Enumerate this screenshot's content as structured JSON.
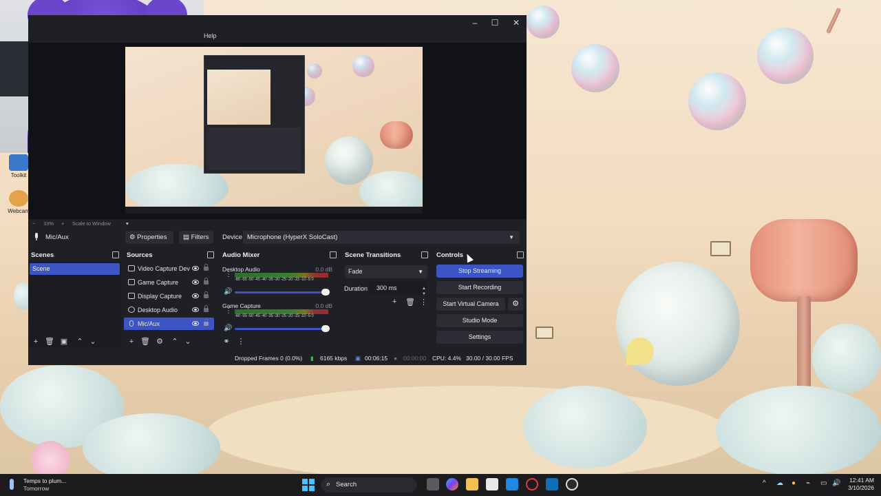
{
  "desktop": {
    "icons": [
      {
        "label": "Toolkit"
      },
      {
        "label": "Webcam"
      }
    ]
  },
  "obs": {
    "window_controls": {
      "minimize": "–",
      "maximize": "☐",
      "close": "✕"
    },
    "menu": {
      "help": "Help"
    },
    "preview_bar": {
      "zoom_minus": "−",
      "zoom_value": "33%",
      "zoom_plus": "+",
      "scale_label": "Scale to Window",
      "caret": "▾"
    },
    "source_toolbar": {
      "source_name": "Mic/Aux",
      "properties_label": "Properties",
      "filters_label": "Filters",
      "device_label": "Device",
      "device_value": "Microphone (HyperX SoloCast)"
    },
    "scenes": {
      "title": "Scenes",
      "items": [
        {
          "label": "Scene"
        }
      ]
    },
    "sources": {
      "title": "Sources",
      "items": [
        {
          "label": "Video Capture Dev"
        },
        {
          "label": "Game Capture"
        },
        {
          "label": "Display Capture"
        },
        {
          "label": "Desktop Audio"
        },
        {
          "label": "Mic/Aux"
        }
      ]
    },
    "audio_mixer": {
      "title": "Audio Mixer",
      "channels": [
        {
          "name": "Desktop Audio",
          "db": "0.0 dB",
          "ticks": "-60 -55 -50 -45 -40 -35 -30 -25 -20 -15 -10 -5 0"
        },
        {
          "name": "Game Capture",
          "db": "0.0 dB",
          "ticks": "-60 -55 -50 -45 -40 -35 -30 -25 -20 -15 -10 -5 0"
        }
      ]
    },
    "scene_transitions": {
      "title": "Scene Transitions",
      "transition": "Fade",
      "duration_label": "Duration",
      "duration_value": "300 ms"
    },
    "controls": {
      "title": "Controls",
      "stop_streaming": "Stop Streaming",
      "start_recording": "Start Recording",
      "start_virtual_camera": "Start Virtual Camera",
      "studio_mode": "Studio Mode",
      "settings": "Settings"
    },
    "status": {
      "dropped_frames": "Dropped Frames 0 (0.0%)",
      "bitrate": "6165 kbps",
      "stream_time": "00:06:15",
      "record_time": "00:00:00",
      "cpu": "CPU: 4.4%",
      "fps": "30.00 / 30.00 FPS"
    },
    "accent_color": "#3b55c4"
  },
  "taskbar": {
    "weather_title": "Temps to plum...",
    "weather_sub": "Tomorrow",
    "search_label": "Search",
    "tray_chevron": "^",
    "time": "12:41 AM",
    "date": "3/10/2026"
  }
}
